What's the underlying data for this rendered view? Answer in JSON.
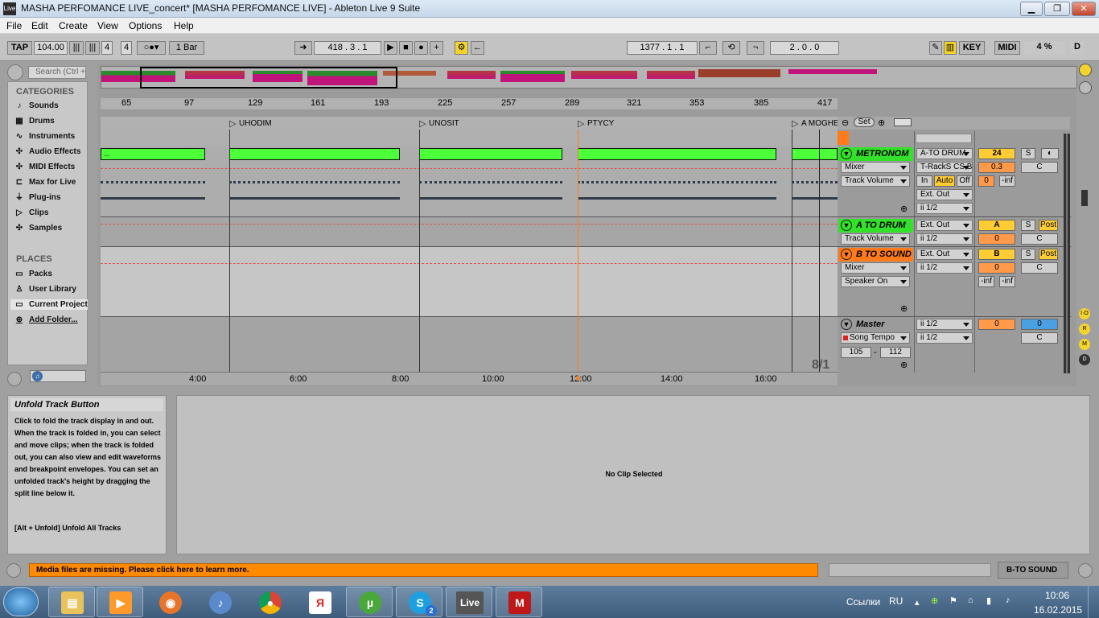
{
  "window": {
    "title": "MASHA PERFOMANCE LIVE_concert*  [MASHA PERFOMANCE LIVE] - Ableton Live 9 Suite",
    "app_icon": "Live"
  },
  "menu": [
    "File",
    "Edit",
    "Create",
    "View",
    "Options",
    "Help"
  ],
  "transport": {
    "tap": "TAP",
    "tempo": "104.00",
    "sig_num": "4",
    "sig_den": "4",
    "quantize": "1 Bar",
    "position": "418 .   3 .   1",
    "loop_start": "1377 .   1 .   1",
    "loop_length": "2 .   0 .   0",
    "key": "KEY",
    "midi": "MIDI",
    "cpu": "4 %",
    "d": "D"
  },
  "browser": {
    "search_placeholder": "Search (Ctrl + F)",
    "categories_title": "CATEGORIES",
    "categories": [
      "Sounds",
      "Drums",
      "Instruments",
      "Audio Effects",
      "MIDI Effects",
      "Max for Live",
      "Plug-ins",
      "Clips",
      "Samples"
    ],
    "places_title": "PLACES",
    "places": [
      "Packs",
      "User Library",
      "Current Project",
      "Add Folder..."
    ]
  },
  "ruler": [
    "65",
    "97",
    "129",
    "161",
    "193",
    "225",
    "257",
    "289",
    "321",
    "353",
    "385",
    "417"
  ],
  "locators": [
    "UHODIM",
    "UNOSIT",
    "PTYCY",
    "A MOGHE"
  ],
  "timeline": [
    "4:00",
    "6:00",
    "8:00",
    "10:00",
    "12:00",
    "14:00",
    "16:00"
  ],
  "zoom_label": "8/1",
  "set_label": "Set",
  "tracks": {
    "metronom": {
      "name": "METRONOM",
      "device": "Mixer",
      "param": "Track Volume",
      "input": "A-TO DRUM",
      "input_ch": "T-RackS CS B",
      "monitor": [
        "In",
        "Auto",
        "Off"
      ],
      "output": "Ext. Out",
      "output_ch": "ii 1/2",
      "volume": "24",
      "send": "0.3",
      "pan": "C",
      "val0": "0",
      "inf": "-inf",
      "solo": "S",
      "clip_label": "..."
    },
    "a_to_drum": {
      "name": "A TO DRUM",
      "param": "Track Volume",
      "output": "Ext. Out",
      "output_ch": "ii 1/2",
      "letter": "A",
      "val0": "0",
      "pan": "C",
      "solo": "S",
      "post": "Post"
    },
    "b_to_sound": {
      "name": "B TO SOUND",
      "device": "Mixer",
      "param": "Speaker On",
      "output": "Ext. Out",
      "output_ch": "ii 1/2",
      "letter": "B",
      "val0": "0",
      "pan": "C",
      "solo": "S",
      "post": "Post",
      "inf1": "-inf",
      "inf2": "-inf"
    },
    "master": {
      "name": "Master",
      "param": "Song Tempo",
      "range_lo": "105",
      "range_sep": "-",
      "range_hi": "112",
      "out1": "ii 1/2",
      "out2": "ii 1/2",
      "val0": "0",
      "cue": "0",
      "pan": "C"
    }
  },
  "side_buttons": [
    "I·O",
    "R",
    "M",
    "D"
  ],
  "info": {
    "title": "Unfold Track Button",
    "body": "Click to fold the track display in and out. When the track is folded in, you can select and move clips; when the track is folded out, you can also view and edit waveforms and breakpoint envelopes. You can set an unfolded track's height by dragging the split line below it.",
    "shortcut": "[Alt + Unfold] Unfold All Tracks"
  },
  "detail": {
    "empty": "No Clip Selected"
  },
  "status": {
    "message": "Media files are missing. Please click here to learn more.",
    "track": "B-TO SOUND"
  },
  "taskbar": {
    "links": "Ссылки",
    "lang": "RU",
    "time": "10:06",
    "date": "16.02.2015",
    "live_label": "Live",
    "yandex": "Я",
    "skype_badge": "2"
  },
  "colors": {
    "clip_green": "#4bff39",
    "track_orange": "#ff7a1a",
    "status_orange": "#ff8a00",
    "volume_yellow": "#ffcc33",
    "track_green": "#33e02a"
  }
}
